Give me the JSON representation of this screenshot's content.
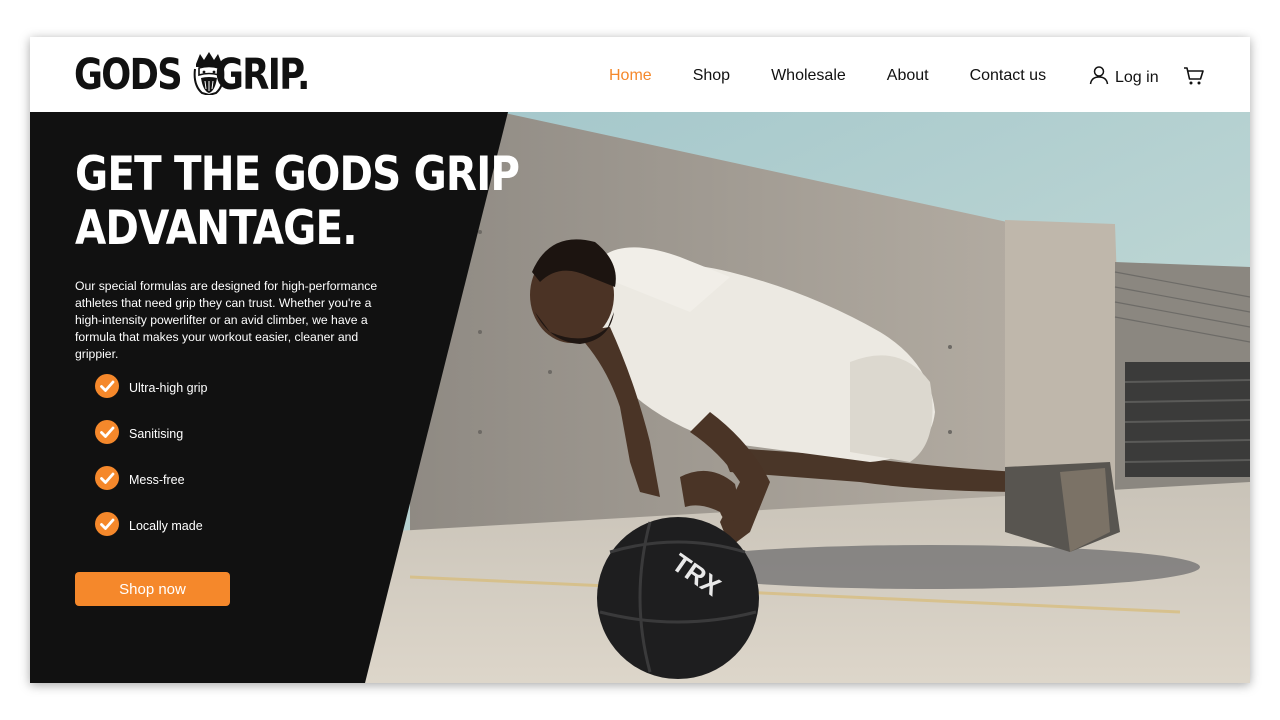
{
  "brand": {
    "word1": "GODS",
    "word2": "GRIP."
  },
  "nav": {
    "items": [
      "Home",
      "Shop",
      "Wholesale",
      "About",
      "Contact us"
    ],
    "active": "Home"
  },
  "account": {
    "login_label": "Log in"
  },
  "hero": {
    "headline_line1": "GET THE GODS GRIP",
    "headline_line2": "ADVANTAGE.",
    "description_lines": [
      "Our special formulas are designed for high-performance",
      "athletes that need grip they can trust. Whether you're a",
      "high-intensity powerlifter or an avid climber, we have a",
      "formula that makes your workout easier, cleaner and grippier."
    ],
    "features": [
      "Ultra-high grip",
      "Sanitising",
      "Mess-free",
      "Locally made"
    ],
    "cta_label": "Shop now",
    "ball_text": "TRX"
  },
  "colors": {
    "accent": "#f5882b",
    "dark_panel": "#111111",
    "text": "#111111"
  },
  "icons": {
    "logo_mark": "king-head-icon",
    "user": "user-icon",
    "cart": "cart-icon",
    "check": "check-circle-icon"
  }
}
